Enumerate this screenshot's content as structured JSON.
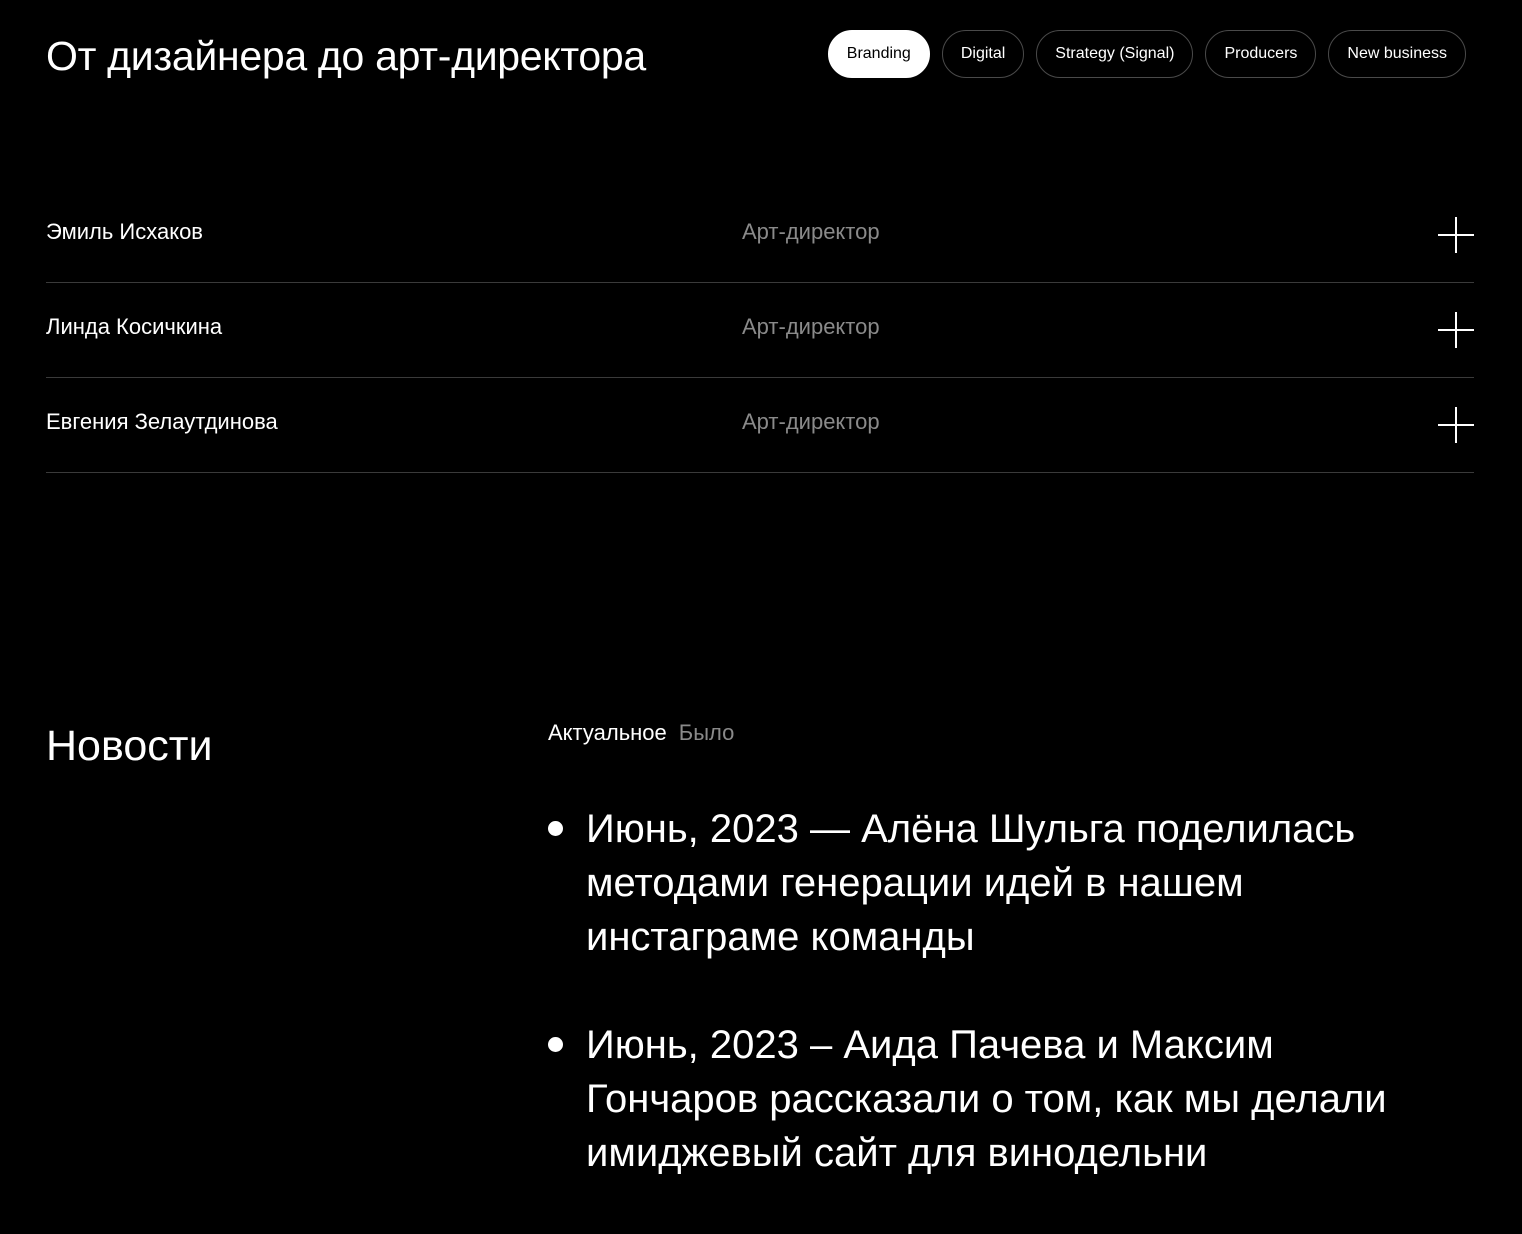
{
  "team": {
    "title": "От дизайнера до арт-директора",
    "filters": [
      {
        "label": "Branding",
        "active": true
      },
      {
        "label": "Digital",
        "active": false
      },
      {
        "label": "Strategy (Signal)",
        "active": false
      },
      {
        "label": "Producers",
        "active": false
      },
      {
        "label": "New business",
        "active": false
      }
    ],
    "people": [
      {
        "name": "Эмиль Исхаков",
        "role": "Арт-директор",
        "icon": "plus-icon"
      },
      {
        "name": "Линда Косичкина",
        "role": "Арт-директор",
        "icon": "plus-icon"
      },
      {
        "name": "Евгения Зелаутдинова",
        "role": "Арт-директор",
        "icon": "plus-icon"
      }
    ]
  },
  "news": {
    "title": "Новости",
    "tabs": [
      {
        "label": "Актуальное",
        "active": true
      },
      {
        "label": "Было",
        "active": false
      }
    ],
    "items": [
      "Июнь, 2023 — Алёна Шульга поделилась методами генерации идей в нашем инстаграме команды",
      "Июнь, 2023 – Аида Пачева и Максим Гончаров рассказали о том, как мы делали имиджевый сайт для винодельни"
    ]
  },
  "colors": {
    "background": "#000000",
    "text": "#ffffff",
    "muted": "#8a8a8a",
    "divider": "#3a3a3a"
  }
}
